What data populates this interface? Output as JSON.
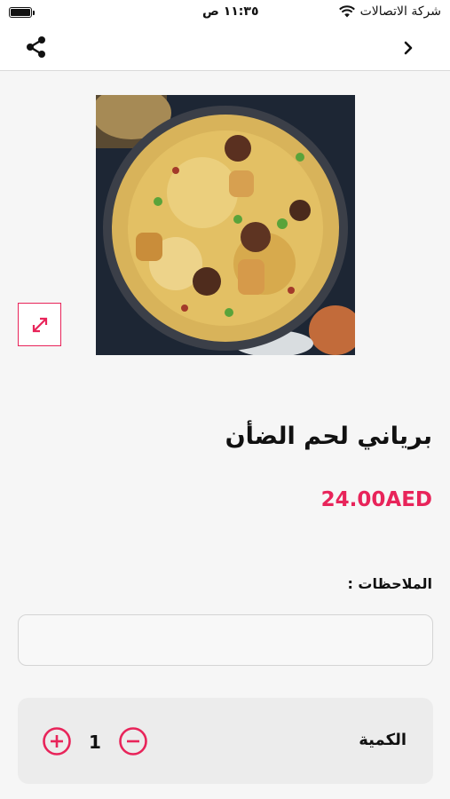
{
  "status_bar": {
    "carrier": "شركة الاتصالات",
    "time": "١١:٣٥ ص",
    "battery_level": 1.0
  },
  "nav": {
    "back_icon": "chevron-right-icon",
    "share_icon": "share-icon"
  },
  "product": {
    "image_alt": "biryani",
    "name": "برياني لحم الضأن",
    "price": "24.00AED"
  },
  "notes": {
    "label": "الملاحظات :",
    "value": "",
    "placeholder": ""
  },
  "quantity": {
    "label": "الكمية",
    "value": "1"
  },
  "colors": {
    "accent": "#e8245a",
    "background": "#f6f6f6",
    "panel": "#ececec"
  }
}
